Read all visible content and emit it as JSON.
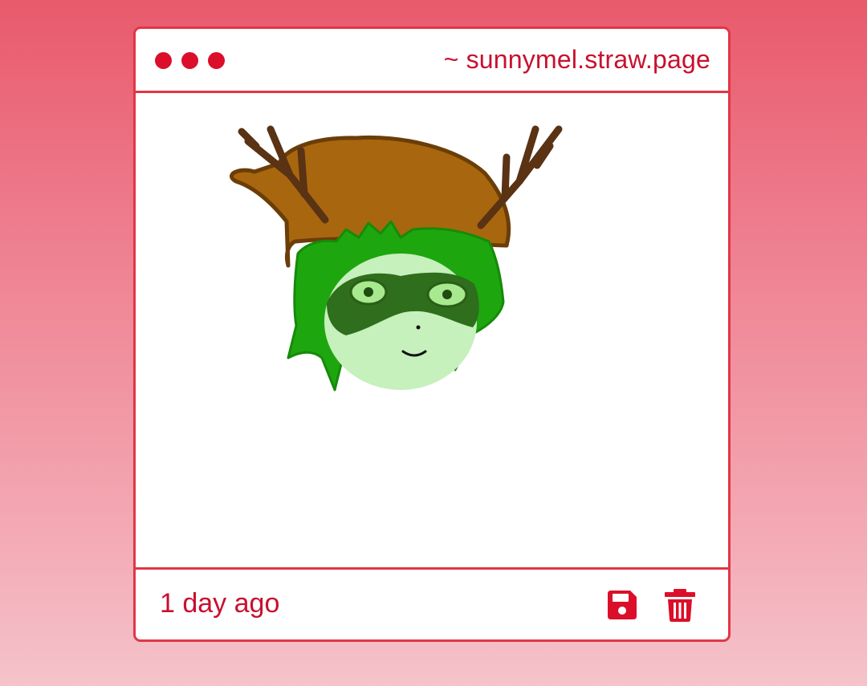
{
  "window": {
    "title": "~ sunnymel.straw.page",
    "traffic_dots": [
      "dot",
      "dot",
      "dot"
    ]
  },
  "post": {
    "timestamp": "1 day ago",
    "drawing": {
      "subject": "green-haired character with antlers, brown hat, dark green mask"
    }
  },
  "actions": {
    "save_icon": "floppy-disk-icon",
    "delete_icon": "trash-icon"
  },
  "colors": {
    "accent": "#db0f2a",
    "border": "#e23645",
    "text": "#c8102e",
    "background_top": "#e85a6c",
    "background_bottom": "#f5c3cb"
  }
}
